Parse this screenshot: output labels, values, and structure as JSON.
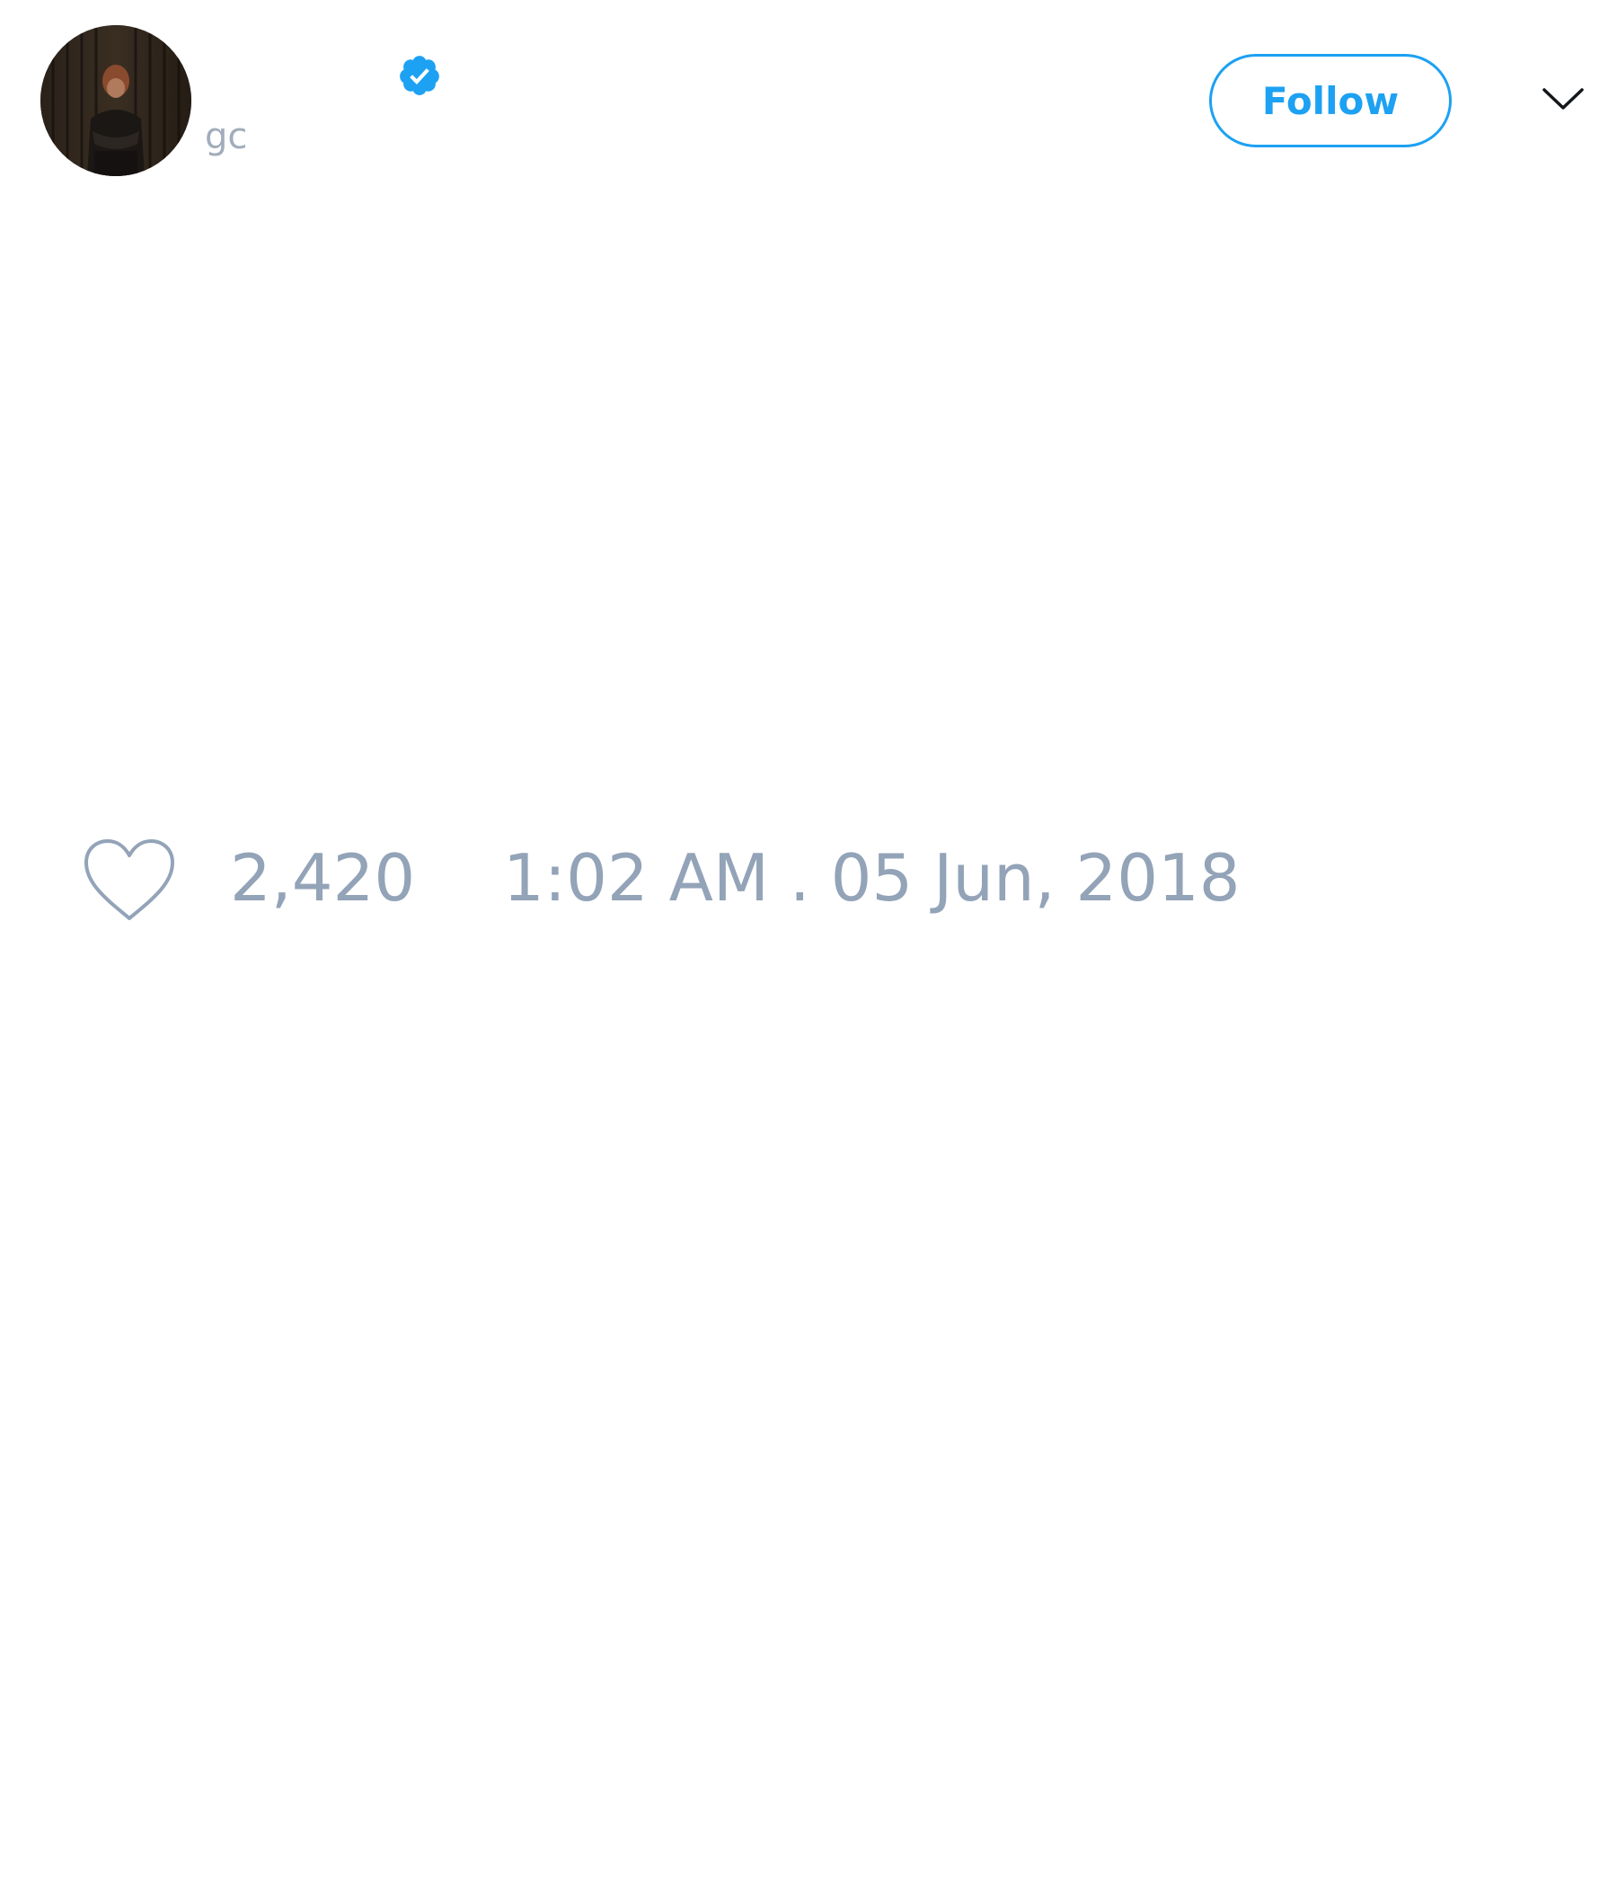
{
  "tweet": {
    "author": {
      "handle": "gc",
      "verified": true,
      "avatar_icon": "user-avatar-photo"
    },
    "follow_button": {
      "label": "Follow",
      "color": "#1da1f2"
    },
    "menu_icon": "chevron-down-icon",
    "likes": {
      "icon": "heart-icon",
      "count": "2,420"
    },
    "timestamp": "1:02 AM . 05 Jun, 2018",
    "muted_text_color": "#93a3b8"
  }
}
